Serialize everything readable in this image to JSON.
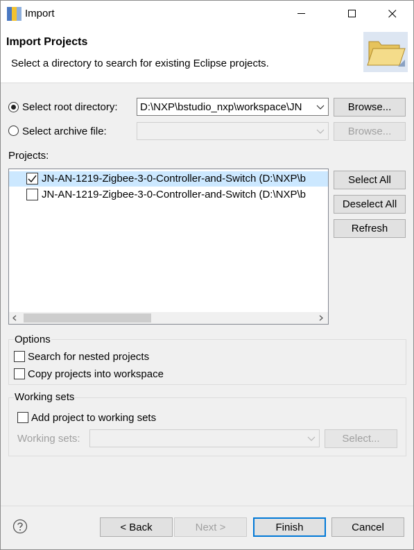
{
  "window": {
    "title": "Import"
  },
  "header": {
    "title": "Import Projects",
    "description": "Select a directory to search for existing Eclipse projects."
  },
  "source": {
    "root_dir_label": "Select root directory:",
    "root_dir_value": "D:\\NXP\\bstudio_nxp\\workspace\\JN",
    "archive_label": "Select archive file:",
    "archive_value": "",
    "browse_label": "Browse...",
    "browse_archive_label": "Browse..."
  },
  "projects": {
    "label": "Projects:",
    "items": [
      {
        "name": "JN-AN-1219-Zigbee-3-0-Controller-and-Switch (D:\\NXP\\b",
        "checked": true
      },
      {
        "name": "JN-AN-1219-Zigbee-3-0-Controller-and-Switch (D:\\NXP\\b",
        "checked": false
      }
    ],
    "select_all": "Select All",
    "deselect_all": "Deselect All",
    "refresh": "Refresh"
  },
  "options": {
    "title": "Options",
    "nested": "Search for nested projects",
    "copy": "Copy projects into workspace"
  },
  "working_sets": {
    "title": "Working sets",
    "add_label": "Add project to working sets",
    "sets_label": "Working sets:",
    "sets_value": "",
    "select_label": "Select..."
  },
  "footer": {
    "back": "< Back",
    "next": "Next >",
    "finish": "Finish",
    "cancel": "Cancel"
  },
  "colors": {
    "selection": "#cce8ff",
    "accent": "#0078d7"
  }
}
